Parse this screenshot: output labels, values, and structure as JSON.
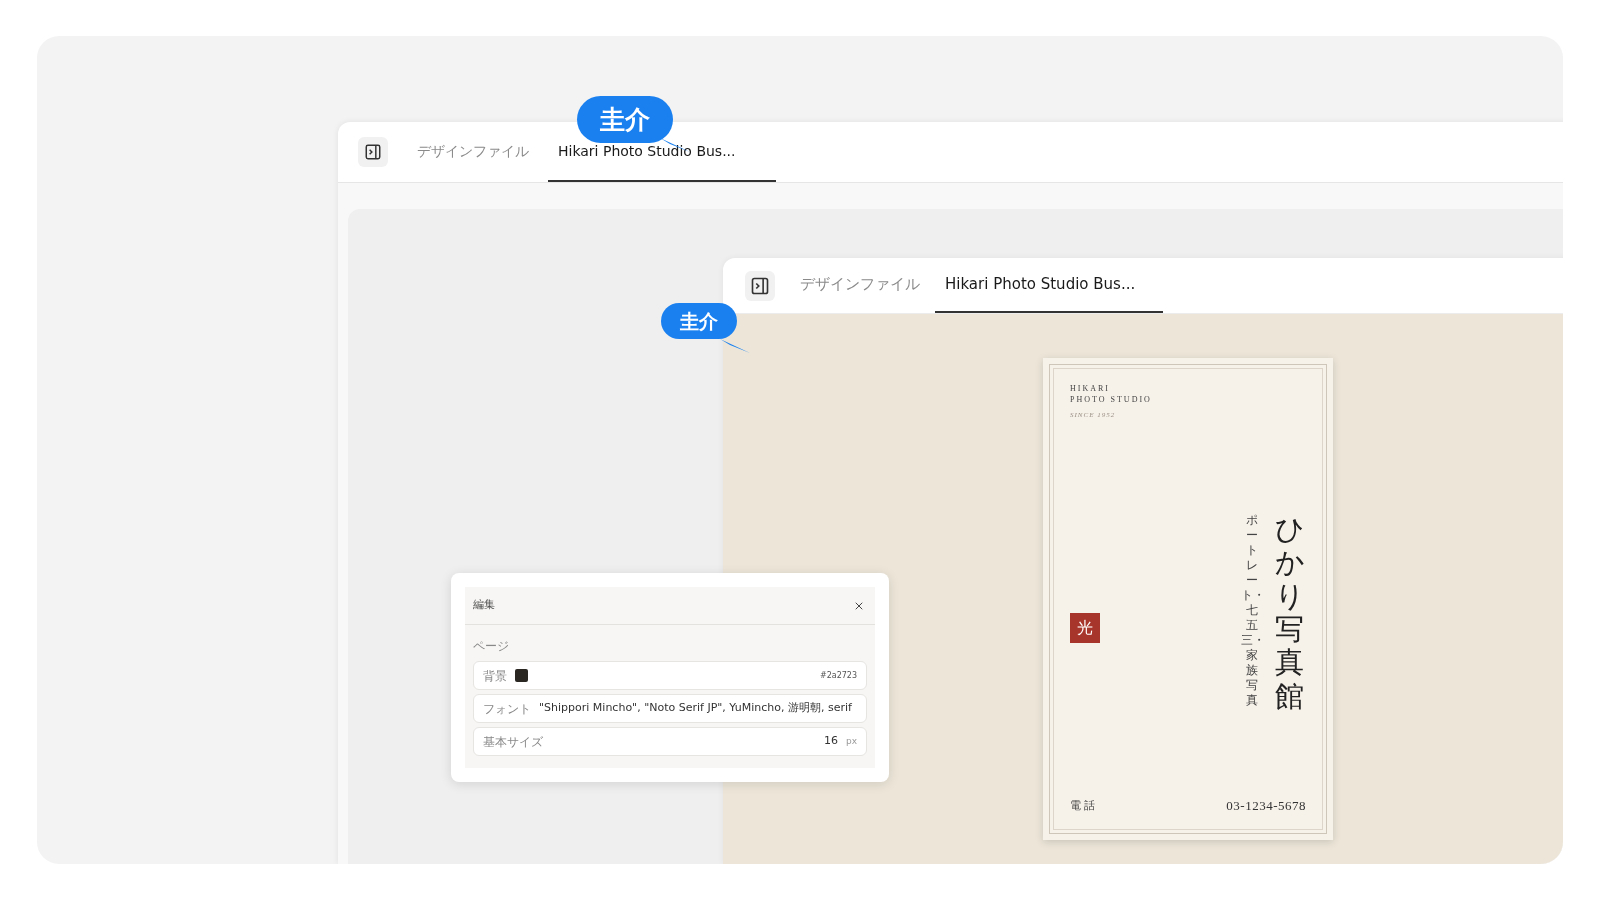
{
  "outer_window": {
    "tabs": [
      {
        "label": "デザインファイル",
        "selected": false
      },
      {
        "label": "Hikari Photo Studio Bus...",
        "selected": true
      }
    ],
    "collaborator": {
      "name": "圭介"
    }
  },
  "inner_window": {
    "tabs": [
      {
        "label": "デザインファイル",
        "selected": false
      },
      {
        "label": "Hikari Photo Studio Bus...",
        "selected": true
      }
    ],
    "collaborator": {
      "name": "圭介"
    }
  },
  "business_card": {
    "brand_lines": [
      "HIKARI",
      "PHOTO STUDIO"
    ],
    "since": "SINCE 1952",
    "seal": "光",
    "title": "ひかり写真館",
    "subtitle": "ポートレート・七五三・家族写真",
    "phone_label": "電 話",
    "phone": "03-1234-5678"
  },
  "edit_panel": {
    "title": "編集",
    "section": "ページ",
    "rows": [
      {
        "kind": "color",
        "label": "背景",
        "value": "#2a2723"
      },
      {
        "kind": "select",
        "label": "フォント",
        "value": "\"Shippori Mincho\", \"Noto Serif JP\", YuMincho, 游明朝, serif"
      },
      {
        "kind": "number",
        "label": "基本サイズ",
        "value": "16",
        "unit": "px"
      }
    ]
  }
}
